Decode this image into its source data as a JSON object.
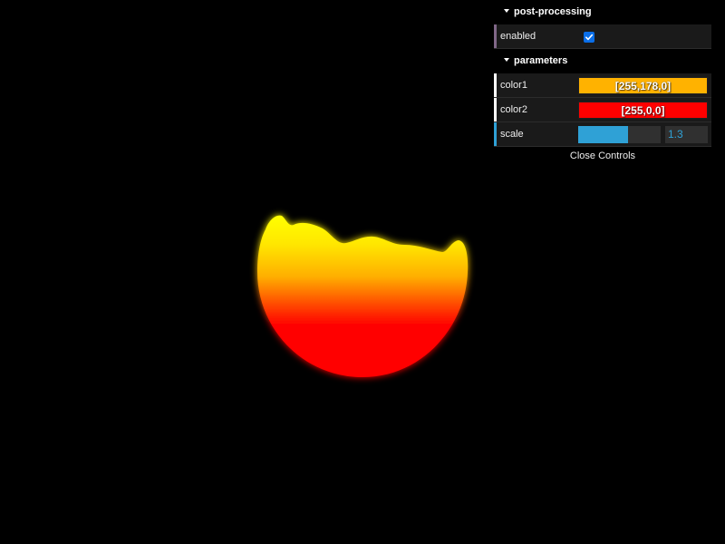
{
  "gui": {
    "folders": [
      {
        "title": "post-processing"
      },
      {
        "title": "parameters"
      }
    ],
    "enabled": {
      "label": "enabled",
      "checked": true
    },
    "color1": {
      "label": "color1",
      "value": "[255,178,0]",
      "hex": "#ffb200"
    },
    "color2": {
      "label": "color2",
      "value": "[255,0,0]",
      "hex": "#ff0000"
    },
    "scale": {
      "label": "scale",
      "value": "1.3",
      "fill_fraction": 0.6
    },
    "close_label": "Close Controls"
  },
  "colors": {
    "slider_accent": "#2fa1d6",
    "checkbox_accent": "#0a6ee8",
    "boolean_row_bar": "#806787",
    "color_row_bar": "#ffffff",
    "number_row_bar": "#2fa1d6"
  }
}
